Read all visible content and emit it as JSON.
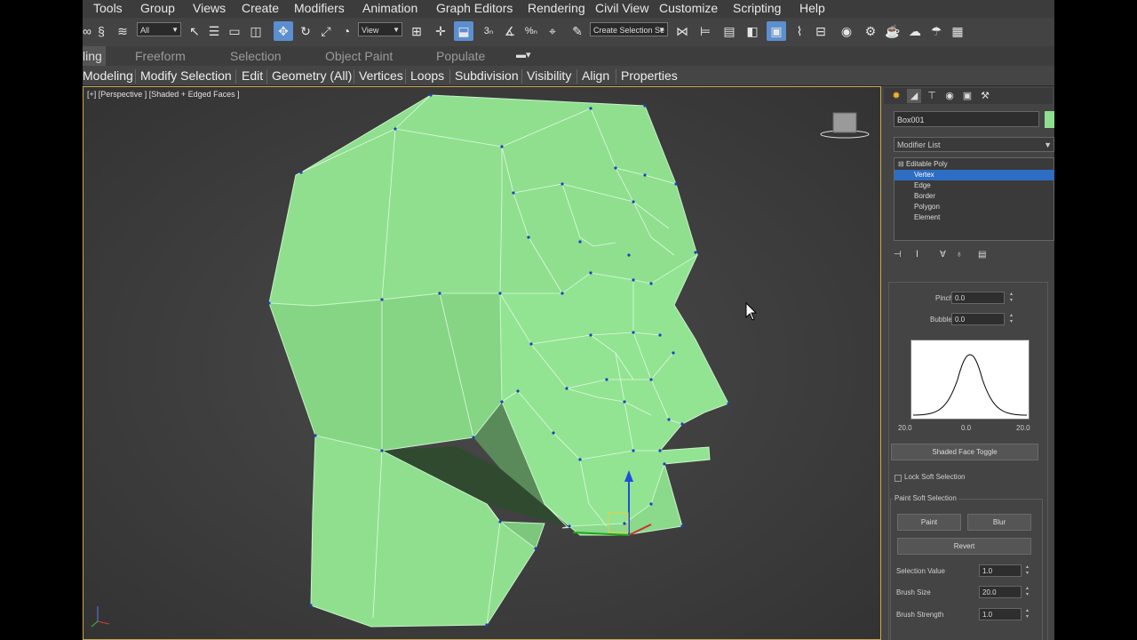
{
  "menu": [
    "Tools",
    "Group",
    "Views",
    "Create",
    "Modifiers",
    "Animation",
    "Graph Editors",
    "Rendering",
    "Civil View",
    "Customize",
    "Scripting",
    "Help"
  ],
  "toolbar": {
    "filter_value": "All",
    "refcoord_value": "View",
    "selection_set": "Create Selection Se"
  },
  "ribbon_tabs": {
    "current": "ling",
    "items": [
      "Freeform",
      "Selection",
      "Object Paint",
      "Populate"
    ]
  },
  "ribbon_items": [
    "Modeling",
    "Modify Selection",
    "Edit",
    "Geometry (All)",
    "Vertices",
    "Loops",
    "Subdivision",
    "Visibility",
    "Align",
    "Properties"
  ],
  "viewport": {
    "label": "[+] [Perspective ] [Shaded + Edged Faces ]"
  },
  "command_panel": {
    "object_name": "Box001",
    "object_color": "#8ee08e",
    "modifier_list": "Modifier List",
    "stack": [
      {
        "label": "Editable Poly",
        "level": 0,
        "selected": false
      },
      {
        "label": "Vertex",
        "level": 1,
        "selected": true
      },
      {
        "label": "Edge",
        "level": 1,
        "selected": false
      },
      {
        "label": "Border",
        "level": 1,
        "selected": false
      },
      {
        "label": "Polygon",
        "level": 1,
        "selected": false
      },
      {
        "label": "Element",
        "level": 1,
        "selected": false
      }
    ],
    "soft_selection": {
      "pinch_label": "Pinch:",
      "pinch": "0.0",
      "bubble_label": "Bubble:",
      "bubble": "0.0",
      "graph_left": "20.0",
      "graph_mid": "0.0",
      "graph_right": "20.0",
      "shaded_face_toggle": "Shaded Face Toggle",
      "lock_soft_selection": "Lock Soft Selection",
      "paint_group": "Paint Soft Selection",
      "paint": "Paint",
      "blur": "Blur",
      "revert": "Revert",
      "selection_value_label": "Selection Value",
      "selection_value": "1.0",
      "brush_size_label": "Brush Size",
      "brush_size": "20.0",
      "brush_strength_label": "Brush Strength",
      "brush_strength": "1.0"
    }
  },
  "colors": {
    "mesh": "#8fdf8f",
    "accent": "#2d6dc3",
    "viewport_border": "#caa84d"
  }
}
